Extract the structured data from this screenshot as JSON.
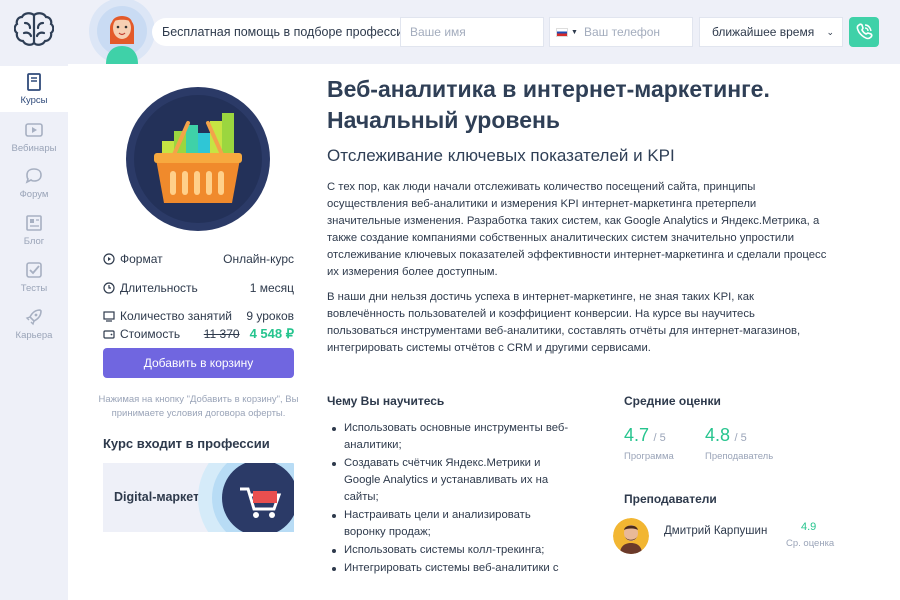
{
  "sidebar": {
    "items": [
      {
        "label": "Курсы",
        "icon": "book-icon",
        "active": true
      },
      {
        "label": "Вебинары",
        "icon": "play-icon"
      },
      {
        "label": "Форум",
        "icon": "chat-icon"
      },
      {
        "label": "Блог",
        "icon": "newspaper-icon"
      },
      {
        "label": "Тесты",
        "icon": "checkbox-icon"
      },
      {
        "label": "Карьера",
        "icon": "rocket-icon"
      }
    ]
  },
  "header": {
    "help_text": "Бесплатная помощь в подборе профессии",
    "name_placeholder": "Ваше имя",
    "phone_placeholder": "Ваш телефон",
    "time_selected": "ближайшее время",
    "call_icon": "phone-icon",
    "accent_color": "#3fd1a8"
  },
  "course": {
    "title": "Веб-аналитика в интернет-маркетинге. Начальный уровень",
    "subtitle": "Отслеживание ключевых показателей и KPI",
    "paragraphs": [
      "С тех пор, как люди начали отслеживать количество посещений сайта, принципы осуществления веб-аналитики и измерения KPI интернет-маркетинга претерпели значительные изменения. Разработка таких систем, как Google Analytics и Яндекс.Метрика, а также создание компаниями собственных аналитических систем значительно упростили отслеживание ключевых показателей эффективности интернет-маркетинга и сделали процесс их измерения более доступным.",
      "В наши дни нельзя достичь успеха в интернет-маркетинге, не зная таких KPI, как вовлечённость пользователей и коэффициент конверсии. На курсе вы научитесь пользоваться инструментами веб-аналитики, составлять отчёты для интернет-магазинов, интегрировать системы отчётов с CRM и другими сервисами."
    ],
    "info": {
      "format_label": "Формат",
      "format_value": "Онлайн-курс",
      "duration_label": "Длительность",
      "duration_value": "1 месяц",
      "lessons_label": "Количество занятий",
      "lessons_value": "9 уроков",
      "price_label": "Стоимость",
      "price_old": "11 370",
      "price_new": "4 548 ₽"
    },
    "cart_button": "Добавить в корзину",
    "cart_note": "Нажимая на кнопку \"Добавить в корзину\", Вы принимаете условия договора оферты.",
    "professions_title": "Курс входит в профессии",
    "profession_name": "Digital-маркетолог",
    "learn_title": "Чему Вы научитесь",
    "learn_items": [
      "Использовать основные инструменты веб-аналитики;",
      "Создавать счётчик Яндекс.Метрики и Google Analytics и устанавливать их на сайты;",
      "Настраивать цели и анализировать воронку продаж;",
      "Использовать системы колл-трекинга;",
      "Интегрировать системы веб-аналитики с"
    ],
    "ratings_title": "Средние оценки",
    "ratings": [
      {
        "value": "4.7",
        "of": "/ 5",
        "caption": "Программа"
      },
      {
        "value": "4.8",
        "of": "/ 5",
        "caption": "Преподаватель"
      }
    ],
    "teachers_title": "Преподаватели",
    "teacher": {
      "name": "Дмитрий Карпушин",
      "score": "4.9",
      "caption": "Ср. оценка"
    },
    "green": "#26c48e",
    "purple": "#7066e0"
  }
}
